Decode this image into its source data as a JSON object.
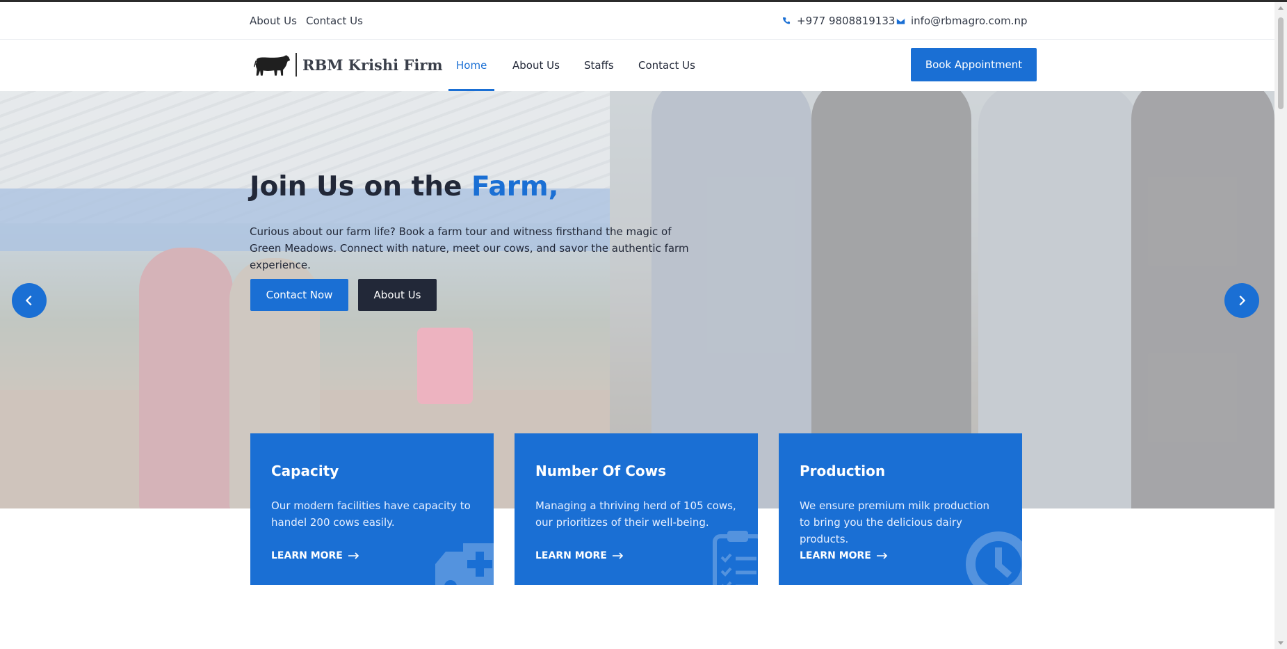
{
  "topbar": {
    "links": [
      "About Us",
      "Contact Us"
    ],
    "phone": "+977 9808819133",
    "email": "info@rbmagro.com.np",
    "phone_icon": "phone-icon",
    "email_icon": "envelope-icon"
  },
  "navbar": {
    "brand": "RBM Krishi Firm",
    "logo_icon": "cow-icon",
    "items": [
      "Home",
      "About Us",
      "Staffs",
      "Contact Us"
    ],
    "active": "Home",
    "cta": "Book Appointment"
  },
  "hero": {
    "title_main": "Join Us on the",
    "title_accent": "Farm,",
    "text": "Curious about our farm life? Book a farm tour and witness firsthand the magic of Green Meadows. Connect with nature, meet our cows, and savor the authentic farm experience.",
    "primary_button": "Contact Now",
    "secondary_button": "About Us",
    "prev_icon": "chevron-left-icon",
    "next_icon": "chevron-right-icon"
  },
  "cards": [
    {
      "title": "Capacity",
      "text": "Our modern facilities have capacity to handel 200 cows easily.",
      "link": "LEARN MORE",
      "icon": "ambulance-icon"
    },
    {
      "title": "Number Of Cows",
      "text": "Managing a thriving herd of 105 cows, our prioritizes of their well-being.",
      "link": "LEARN MORE",
      "icon": "clipboard-list-icon"
    },
    {
      "title": "Production",
      "text": "We ensure premium milk production to bring you the delicious dairy products.",
      "link": "LEARN MORE",
      "icon": "clock-icon"
    }
  ],
  "colors": {
    "primary": "#1a6fd4",
    "dark": "#222838"
  }
}
